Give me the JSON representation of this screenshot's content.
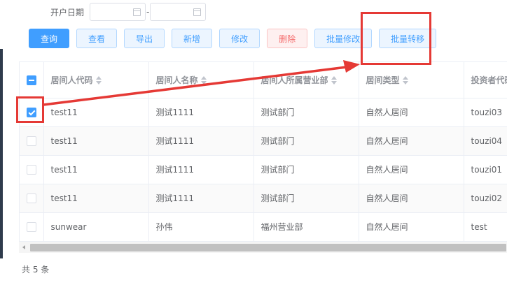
{
  "filter": {
    "open_date_label": "开户日期",
    "date_separator": "-",
    "start_date_placeholder": "",
    "end_date_placeholder": ""
  },
  "toolbar": {
    "query": "查询",
    "view": "查看",
    "export": "导出",
    "add": "新增",
    "edit": "修改",
    "delete": "删除",
    "batch_edit": "批量修改",
    "batch_transfer": "批量转移"
  },
  "table": {
    "columns": [
      "居间人代码",
      "居间人名称",
      "居间人所属营业部",
      "居间类型",
      "投资者代码"
    ],
    "rows": [
      {
        "checked": true,
        "code": "test11",
        "name": "测试1111",
        "branch": "测试部门",
        "type": "自然人居间",
        "investor": "touzi03"
      },
      {
        "checked": false,
        "code": "test11",
        "name": "测试1111",
        "branch": "测试部门",
        "type": "自然人居间",
        "investor": "touzi04"
      },
      {
        "checked": false,
        "code": "test11",
        "name": "测试1111",
        "branch": "测试部门",
        "type": "自然人居间",
        "investor": "touzi01"
      },
      {
        "checked": false,
        "code": "test11",
        "name": "测试1111",
        "branch": "测试部门",
        "type": "自然人居间",
        "investor": "touzi02"
      },
      {
        "checked": false,
        "code": "sunwear",
        "name": "孙伟",
        "branch": "福州营业部",
        "type": "自然人居间",
        "investor": "test"
      }
    ]
  },
  "pagination": {
    "total_text": "共 5 条"
  },
  "colors": {
    "primary": "#409eff",
    "danger": "#f56c6c",
    "annotation": "#e53935"
  }
}
